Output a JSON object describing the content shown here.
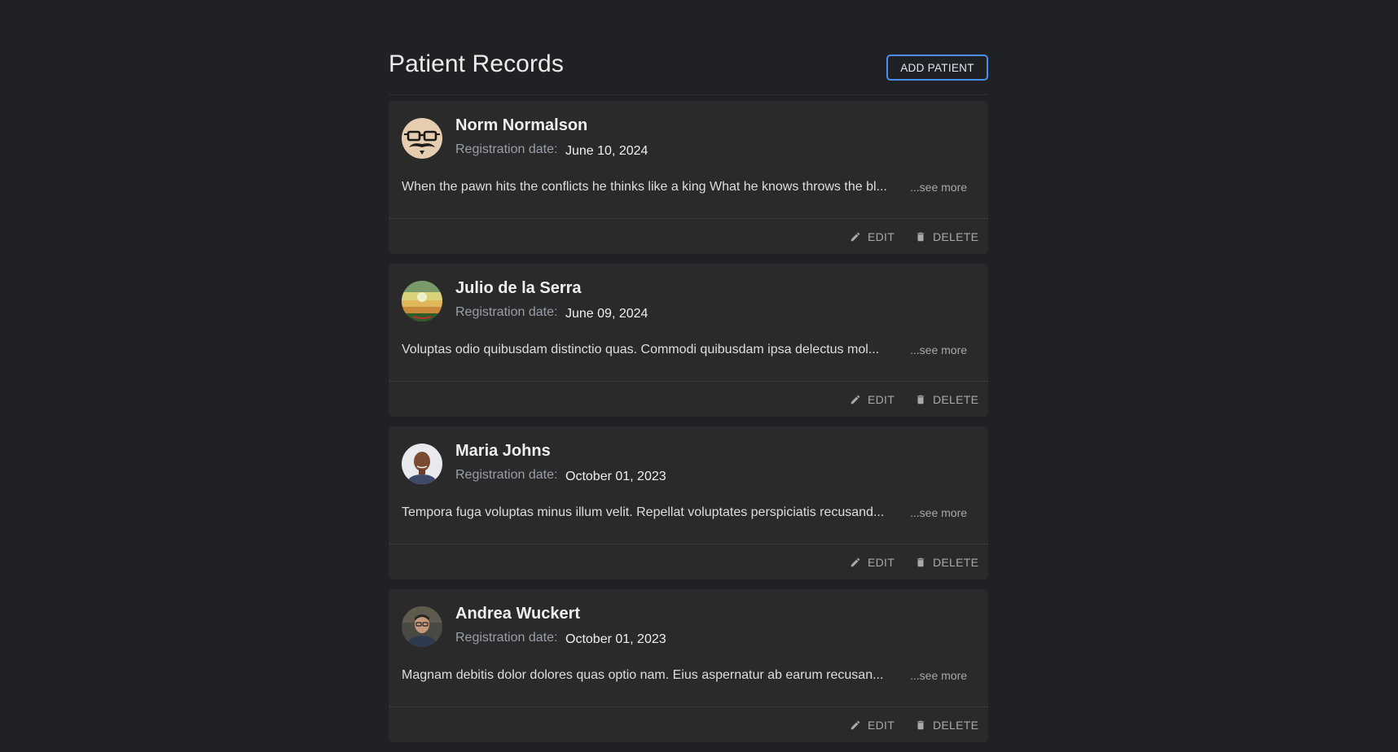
{
  "header": {
    "title": "Patient Records",
    "add_button_label": "ADD PATIENT"
  },
  "card_labels": {
    "registration_label": "Registration date:",
    "see_more": "...see more",
    "edit": "EDIT",
    "delete": "DELETE"
  },
  "patients": [
    {
      "name": "Norm Normalson",
      "registration_date": "June 10, 2024",
      "description": "When the pawn hits the conflicts he thinks like a king What he knows throws the bl...",
      "avatar": "mustache-glasses-avatar-icon"
    },
    {
      "name": "Julio de la Serra",
      "registration_date": "June 09, 2024",
      "description": "Voluptas odio quibusdam distinctio quas. Commodi quibusdam ipsa delectus mol...",
      "avatar": "landscape-photo-avatar"
    },
    {
      "name": "Maria Johns",
      "registration_date": "October 01, 2023",
      "description": "Tempora fuga voluptas minus illum velit. Repellat voluptates perspiciatis recusand...",
      "avatar": "portrait-photo-avatar"
    },
    {
      "name": "Andrea Wuckert",
      "registration_date": "October 01, 2023",
      "description": "Magnam debitis dolor dolores quas optio nam. Eius aspernatur ab earum recusan...",
      "avatar": "portrait-photo-avatar"
    }
  ],
  "colors": {
    "background": "#202124",
    "card": "#2a2a2b",
    "accent": "#4a8ff0"
  }
}
